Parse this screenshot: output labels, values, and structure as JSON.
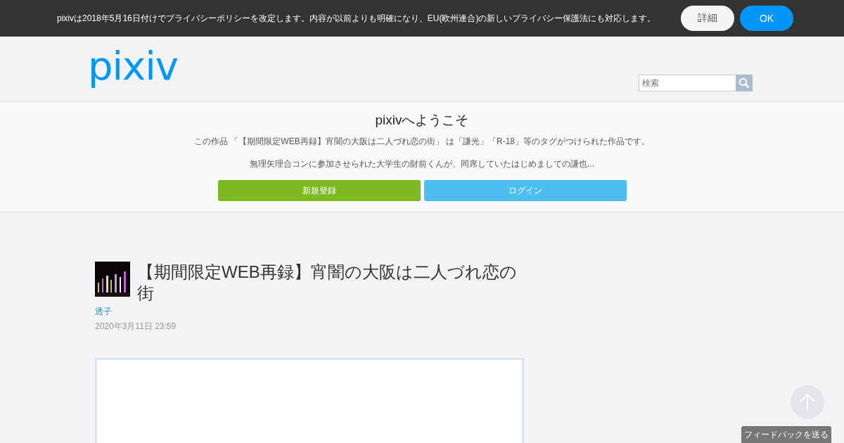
{
  "notice": {
    "text": "pixivは2018年5月16日付けでプライバシーポリシーを改定します。内容が以前よりも明確になり、EU(欧州連合)の新しいプライバシー保護法にも対応します。",
    "buttons": [
      {
        "label": "詳細",
        "kind": "secondary"
      },
      {
        "label": "OK",
        "kind": "primary"
      }
    ]
  },
  "header": {
    "logo": "pixiv",
    "search": {
      "placeholder": "検索"
    }
  },
  "welcome": {
    "title": "pixivへようこそ",
    "description": "この作品 「【期間限定WEB再録】宵闇の大阪は二人づれ恋の街」 は「謙光」「R-18」等のタグがつけられた作品です。",
    "summary": "無理矢理合コンに参加させられた大学生の財前くんが、同席していたはじめましての謙也...",
    "buttons": [
      {
        "label": "新規登録",
        "kind": "signup"
      },
      {
        "label": "ログイン",
        "kind": "login"
      }
    ]
  },
  "work": {
    "title": "【期間限定WEB再録】宵闇の大阪は二人づれ恋の街",
    "author": "透子",
    "date": "2020年3月11日 23:59"
  },
  "feedback": {
    "label": "フィードバックを送る"
  }
}
